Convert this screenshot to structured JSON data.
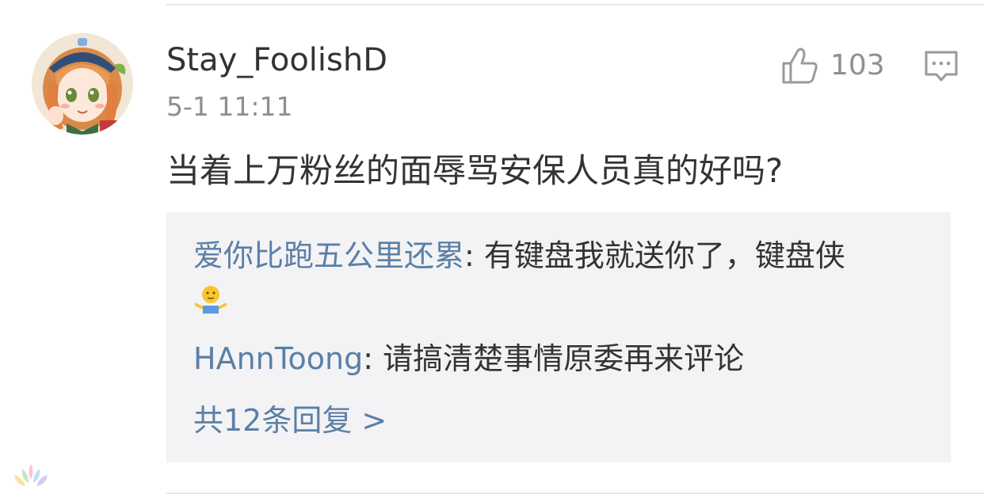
{
  "comment": {
    "username": "Stay_FoolishD",
    "timestamp": "5-1 11:11",
    "like_count": "103",
    "text": "当着上万粉丝的面辱骂安保人员真的好吗?"
  },
  "replies": [
    {
      "author": "爱你比跑五公里还累",
      "separator": ": ",
      "text": "有键盘我就送你了，键盘侠",
      "emoji": "shrug-emoji"
    },
    {
      "author": "HAnnToong",
      "separator": ": ",
      "text": "请搞清楚事情原委再来评论"
    }
  ],
  "more_replies": "共12条回复 >",
  "icons": {
    "like": "thumbs-up-icon",
    "reply": "comment-bubble-icon"
  },
  "colors": {
    "username": "#333333",
    "meta_gray": "#8f8f8f",
    "link_blue": "#5b7fa6",
    "reply_bg": "#f3f3f5"
  }
}
